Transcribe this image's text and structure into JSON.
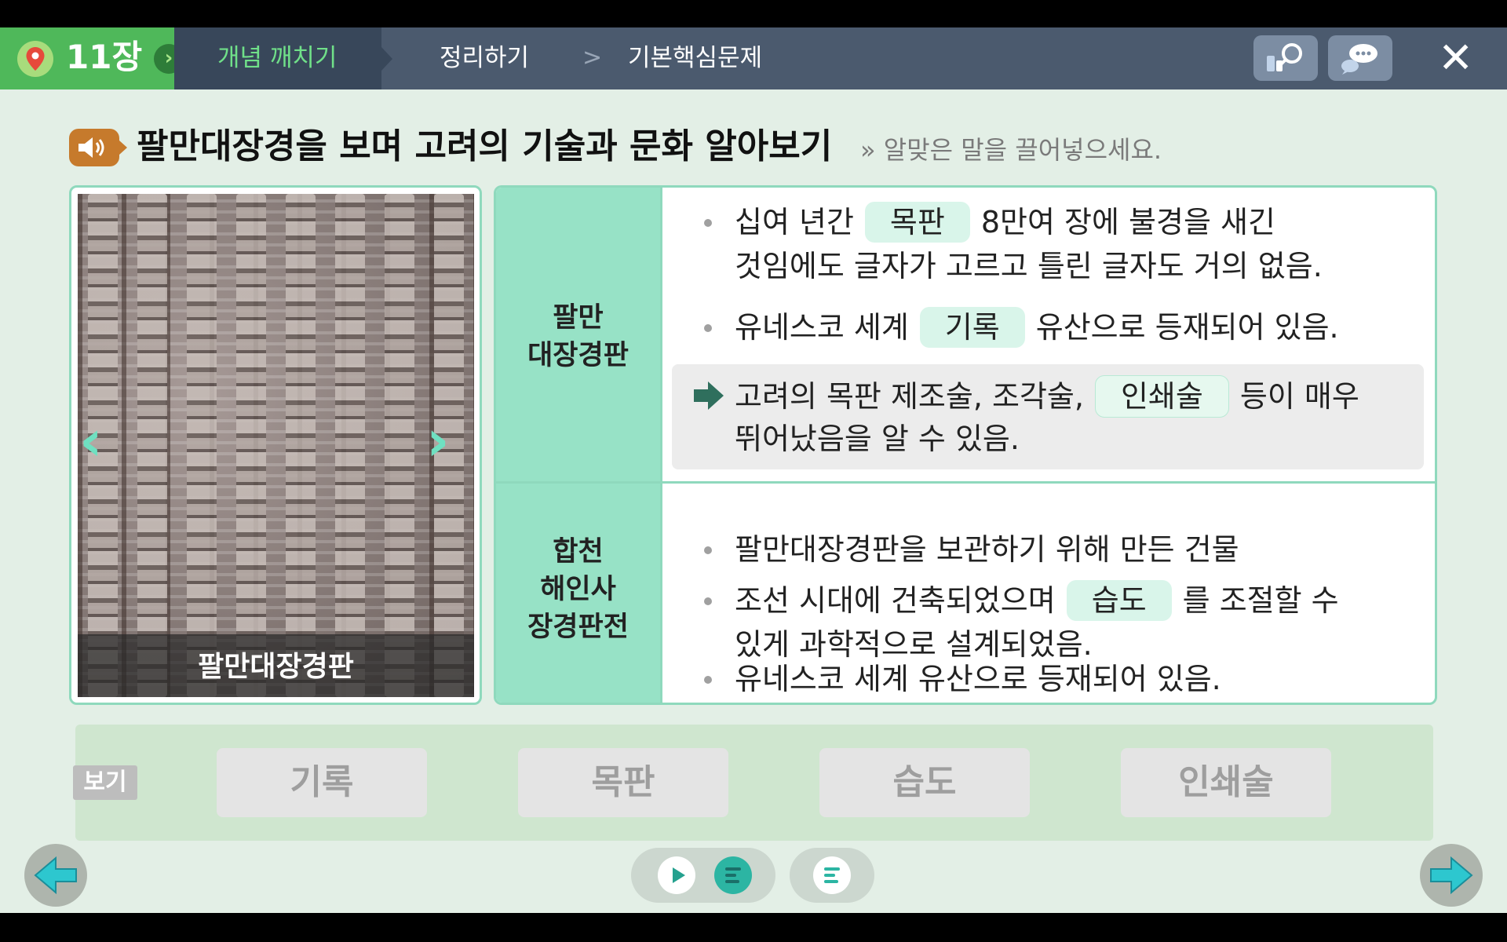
{
  "topbar": {
    "chapter": "11장",
    "tabs": [
      "개념 깨치기",
      "정리하기",
      "기본핵심문제"
    ],
    "crumb_separator": ">"
  },
  "header": {
    "title": "팔만대장경을 보며 고려의 기술과 문화 알아보기",
    "instruction": "» 알맞은 말을 끌어넣으세요."
  },
  "image_panel": {
    "caption": "팔만대장경판"
  },
  "table": {
    "rows": [
      {
        "header_line1": "팔만",
        "header_line2": "대장경판",
        "b1_pre": "십여 년간",
        "b1_blank": "목판",
        "b1_post": "8만여 장에 불경을 새긴",
        "b1_line2": "것임에도 글자가 고르고 틀린 글자도 거의 없음.",
        "b2_pre": "유네스코 세계",
        "b2_blank": "기록",
        "b2_post": "유산으로 등재되어 있음.",
        "c_pre": "고려의 목판 제조술, 조각술,",
        "c_blank": "인쇄술",
        "c_post": "등이 매우",
        "c_line2": "뛰어났음을 알 수 있음."
      },
      {
        "header_line1": "합천",
        "header_line2": "해인사",
        "header_line3": "장경판전",
        "b1": "팔만대장경판을 보관하기 위해 만든 건물",
        "b2_pre": "조선 시대에 건축되었으며",
        "b2_blank": "습도",
        "b2_post": "를 조절할 수",
        "b2_line2": "있게 과학적으로 설계되었음.",
        "b3": "유네스코 세계 유산으로 등재되어 있음."
      }
    ]
  },
  "options": {
    "tag": "보기",
    "items": [
      "기록",
      "목판",
      "습도",
      "인쇄술"
    ]
  },
  "icons": {
    "chapter": "location-pin-icon",
    "search": "book-search-icon",
    "chat": "chat-bubble-icon",
    "close": "close-icon",
    "speaker": "speaker-icon",
    "prev": "arrow-left-icon",
    "next": "arrow-right-icon"
  },
  "colors": {
    "accent_green": "#4fb85a",
    "active_tab_text": "#70e089",
    "table_header": "#97e2c6",
    "blank_fill": "#d9f5ea",
    "background": "#e3efe6"
  }
}
